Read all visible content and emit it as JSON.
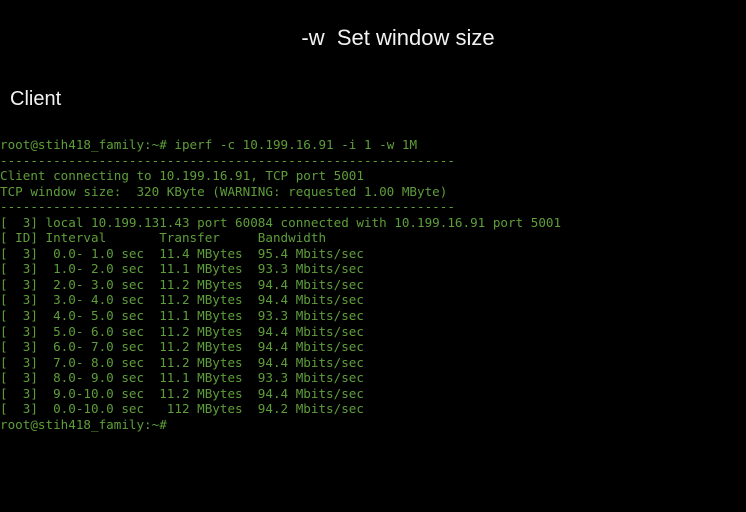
{
  "slide": {
    "title": "-w  Set window size",
    "subtitle": "Client"
  },
  "terminal": {
    "prompt": "root@stih418_family:~#",
    "command": " iperf -c 10.199.16.91 -i 1 -w 1M",
    "separator": "------------------------------------------------------------",
    "connect_line": "Client connecting to 10.199.16.91, TCP port 5001",
    "window_line": "TCP window size:  320 KByte (WARNING: requested 1.00 MByte)",
    "conn_info": "[  3] local 10.199.131.43 port 60084 connected with 10.199.16.91 port 5001",
    "table_header": "[ ID] Interval       Transfer     Bandwidth",
    "rows": [
      "[  3]  0.0- 1.0 sec  11.4 MBytes  95.4 Mbits/sec",
      "[  3]  1.0- 2.0 sec  11.1 MBytes  93.3 Mbits/sec",
      "[  3]  2.0- 3.0 sec  11.2 MBytes  94.4 Mbits/sec",
      "[  3]  3.0- 4.0 sec  11.2 MBytes  94.4 Mbits/sec",
      "[  3]  4.0- 5.0 sec  11.1 MBytes  93.3 Mbits/sec",
      "[  3]  5.0- 6.0 sec  11.2 MBytes  94.4 Mbits/sec",
      "[  3]  6.0- 7.0 sec  11.2 MBytes  94.4 Mbits/sec",
      "[  3]  7.0- 8.0 sec  11.2 MBytes  94.4 Mbits/sec",
      "[  3]  8.0- 9.0 sec  11.1 MBytes  93.3 Mbits/sec",
      "[  3]  9.0-10.0 sec  11.2 MBytes  94.4 Mbits/sec",
      "[  3]  0.0-10.0 sec   112 MBytes  94.2 Mbits/sec"
    ],
    "final_prompt": "root@stih418_family:~#"
  },
  "colors": {
    "background": "#000000",
    "terminal_text": "#5e9e3a",
    "slide_text": "#f2f2f2"
  }
}
